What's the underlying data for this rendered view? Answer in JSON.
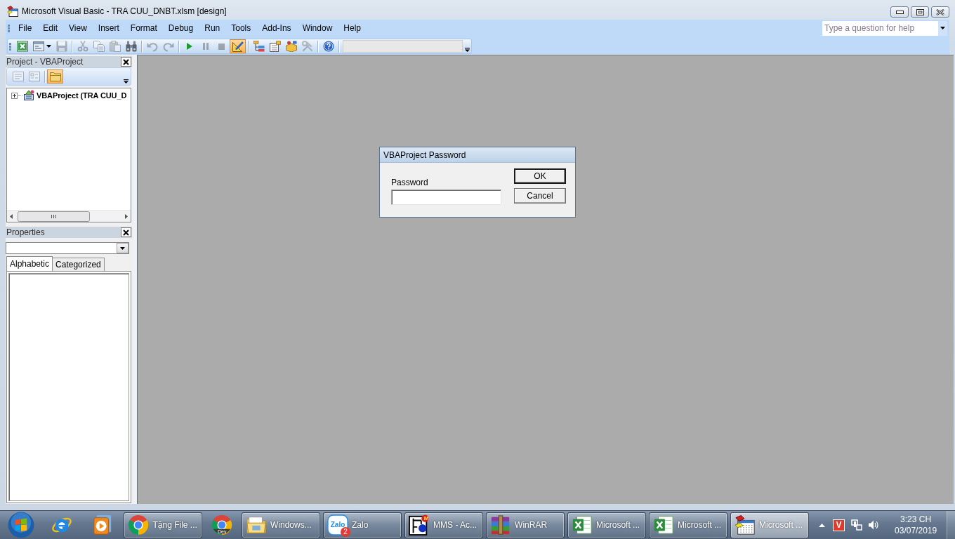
{
  "window": {
    "title": "Microsoft Visual Basic - TRA CUU_DNBT.xlsm [design]"
  },
  "menu_bar": {
    "items": [
      {
        "label": "File"
      },
      {
        "label": "Edit"
      },
      {
        "label": "View"
      },
      {
        "label": "Insert"
      },
      {
        "label": "Format"
      },
      {
        "label": "Debug"
      },
      {
        "label": "Run"
      },
      {
        "label": "Tools"
      },
      {
        "label": "Add-Ins"
      },
      {
        "label": "Window"
      },
      {
        "label": "Help"
      }
    ],
    "help_box": {
      "placeholder": "Type a question for help"
    }
  },
  "toolbar": {
    "buttons": [
      {
        "disabled": false,
        "pressed": false
      },
      {
        "disabled": false,
        "pressed": false
      },
      {
        "disabled": true,
        "pressed": false
      },
      {
        "disabled": true,
        "pressed": false
      },
      {
        "disabled": true,
        "pressed": false
      },
      {
        "disabled": true,
        "pressed": false
      },
      {
        "disabled": false,
        "pressed": false
      },
      {
        "disabled": true,
        "pressed": false
      },
      {
        "disabled": true,
        "pressed": false
      },
      {
        "disabled": false,
        "pressed": false
      },
      {
        "disabled": true,
        "pressed": false
      },
      {
        "disabled": true,
        "pressed": false
      },
      {
        "disabled": false,
        "pressed": true
      },
      {
        "disabled": false,
        "pressed": false
      },
      {
        "disabled": false,
        "pressed": false
      },
      {
        "disabled": false,
        "pressed": false
      },
      {
        "disabled": true,
        "pressed": false
      },
      {
        "disabled": false,
        "pressed": false
      }
    ]
  },
  "project_panel": {
    "title": "Project - VBAProject",
    "toolbar": [
      {
        "disabled": true,
        "pressed": false
      },
      {
        "disabled": true,
        "pressed": false
      },
      {
        "disabled": false,
        "pressed": true
      }
    ],
    "tree": [
      {
        "label": "VBAProject (TRA CUU_D",
        "expanded": false
      }
    ]
  },
  "properties_panel": {
    "title": "Properties",
    "tabs": [
      {
        "label": "Alphabetic",
        "selected": true
      },
      {
        "label": "Categorized",
        "selected": false
      }
    ]
  },
  "dialog": {
    "title": "VBAProject Password",
    "field_label": "Password",
    "buttons": [
      {
        "label": "OK",
        "default": true
      },
      {
        "label": "Cancel",
        "default": false
      }
    ]
  },
  "taskbar": {
    "items": [
      {
        "kind": "start",
        "selected": false
      },
      {
        "kind": "pinned",
        "selected": false
      },
      {
        "kind": "pinned",
        "selected": false
      },
      {
        "kind": "task",
        "label": "Tặng File ...",
        "selected": false
      },
      {
        "kind": "pinned",
        "icon_text": "Dev",
        "selected": false
      },
      {
        "kind": "task",
        "label": "Windows...",
        "selected": false
      },
      {
        "kind": "task",
        "label": "Zalo",
        "icon_text": "Zalo",
        "badge": "2",
        "selected": false
      },
      {
        "kind": "task",
        "label": "MMS - Ac...",
        "icon_text": "M",
        "selected": false
      },
      {
        "kind": "task",
        "label": "WinRAR",
        "selected": false
      },
      {
        "kind": "task",
        "label": "Microsoft ...",
        "selected": false
      },
      {
        "kind": "task",
        "label": "Microsoft ...",
        "selected": false
      },
      {
        "kind": "task",
        "label": "Microsoft ...",
        "selected": true
      }
    ],
    "tray": {
      "app_icon_text": "V"
    },
    "clock": {
      "time": "3:23 CH",
      "date": "03/07/2019"
    }
  }
}
